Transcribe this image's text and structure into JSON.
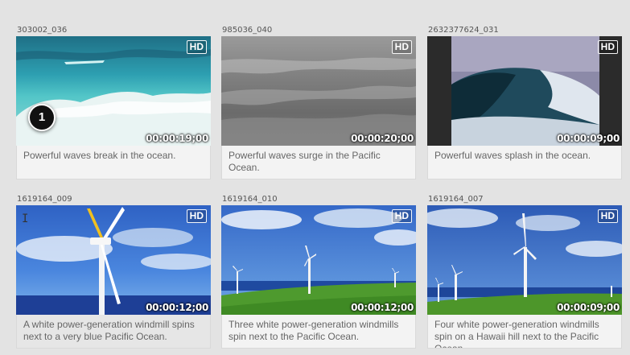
{
  "clips": [
    {
      "id": "303002_036",
      "hd": "HD",
      "duration": "00:00:19;00",
      "caption": "Powerful waves break in the ocean."
    },
    {
      "id": "985036_040",
      "hd": "HD",
      "duration": "00:00:20;00",
      "caption": "Powerful waves surge in the Pacific Ocean."
    },
    {
      "id": "2632377624_031",
      "hd": "HD",
      "duration": "00:00:09;00",
      "caption": "Powerful waves splash in the ocean."
    },
    {
      "id": "1619164_009",
      "hd": "HD",
      "duration": "00:00:12;00",
      "caption": "A white power-generation windmill spins next to a very blue Pacific Ocean."
    },
    {
      "id": "1619164_010",
      "hd": "HD",
      "duration": "00:00:12;00",
      "caption": "Three white power-generation windmills spin next to the Pacific Ocean."
    },
    {
      "id": "1619164_007",
      "hd": "HD",
      "duration": "00:00:09;00",
      "caption": "Four white power-generation windmills spin on a Hawaii hill next to the Pacific Ocean."
    }
  ],
  "marker": {
    "label": "1"
  },
  "thumbnails": [
    "turquoise-wave",
    "grayscale-wave",
    "barrel-wave",
    "single-windmill",
    "three-windmills",
    "four-windmills"
  ]
}
